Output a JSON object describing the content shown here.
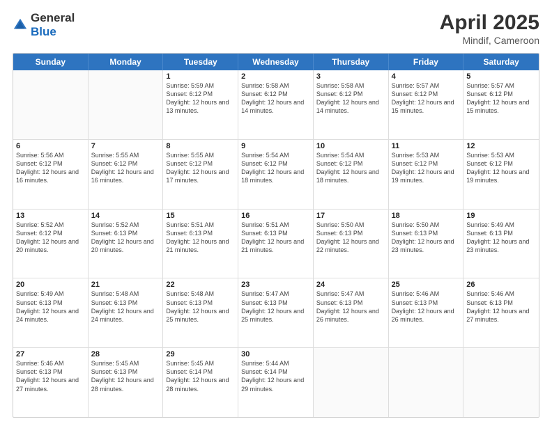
{
  "header": {
    "logo_general": "General",
    "logo_blue": "Blue",
    "title": "April 2025",
    "location": "Mindif, Cameroon"
  },
  "days_of_week": [
    "Sunday",
    "Monday",
    "Tuesday",
    "Wednesday",
    "Thursday",
    "Friday",
    "Saturday"
  ],
  "weeks": [
    [
      {
        "day": "",
        "sunrise": "",
        "sunset": "",
        "daylight": ""
      },
      {
        "day": "",
        "sunrise": "",
        "sunset": "",
        "daylight": ""
      },
      {
        "day": "1",
        "sunrise": "Sunrise: 5:59 AM",
        "sunset": "Sunset: 6:12 PM",
        "daylight": "Daylight: 12 hours and 13 minutes."
      },
      {
        "day": "2",
        "sunrise": "Sunrise: 5:58 AM",
        "sunset": "Sunset: 6:12 PM",
        "daylight": "Daylight: 12 hours and 14 minutes."
      },
      {
        "day": "3",
        "sunrise": "Sunrise: 5:58 AM",
        "sunset": "Sunset: 6:12 PM",
        "daylight": "Daylight: 12 hours and 14 minutes."
      },
      {
        "day": "4",
        "sunrise": "Sunrise: 5:57 AM",
        "sunset": "Sunset: 6:12 PM",
        "daylight": "Daylight: 12 hours and 15 minutes."
      },
      {
        "day": "5",
        "sunrise": "Sunrise: 5:57 AM",
        "sunset": "Sunset: 6:12 PM",
        "daylight": "Daylight: 12 hours and 15 minutes."
      }
    ],
    [
      {
        "day": "6",
        "sunrise": "Sunrise: 5:56 AM",
        "sunset": "Sunset: 6:12 PM",
        "daylight": "Daylight: 12 hours and 16 minutes."
      },
      {
        "day": "7",
        "sunrise": "Sunrise: 5:55 AM",
        "sunset": "Sunset: 6:12 PM",
        "daylight": "Daylight: 12 hours and 16 minutes."
      },
      {
        "day": "8",
        "sunrise": "Sunrise: 5:55 AM",
        "sunset": "Sunset: 6:12 PM",
        "daylight": "Daylight: 12 hours and 17 minutes."
      },
      {
        "day": "9",
        "sunrise": "Sunrise: 5:54 AM",
        "sunset": "Sunset: 6:12 PM",
        "daylight": "Daylight: 12 hours and 18 minutes."
      },
      {
        "day": "10",
        "sunrise": "Sunrise: 5:54 AM",
        "sunset": "Sunset: 6:12 PM",
        "daylight": "Daylight: 12 hours and 18 minutes."
      },
      {
        "day": "11",
        "sunrise": "Sunrise: 5:53 AM",
        "sunset": "Sunset: 6:12 PM",
        "daylight": "Daylight: 12 hours and 19 minutes."
      },
      {
        "day": "12",
        "sunrise": "Sunrise: 5:53 AM",
        "sunset": "Sunset: 6:12 PM",
        "daylight": "Daylight: 12 hours and 19 minutes."
      }
    ],
    [
      {
        "day": "13",
        "sunrise": "Sunrise: 5:52 AM",
        "sunset": "Sunset: 6:12 PM",
        "daylight": "Daylight: 12 hours and 20 minutes."
      },
      {
        "day": "14",
        "sunrise": "Sunrise: 5:52 AM",
        "sunset": "Sunset: 6:13 PM",
        "daylight": "Daylight: 12 hours and 20 minutes."
      },
      {
        "day": "15",
        "sunrise": "Sunrise: 5:51 AM",
        "sunset": "Sunset: 6:13 PM",
        "daylight": "Daylight: 12 hours and 21 minutes."
      },
      {
        "day": "16",
        "sunrise": "Sunrise: 5:51 AM",
        "sunset": "Sunset: 6:13 PM",
        "daylight": "Daylight: 12 hours and 21 minutes."
      },
      {
        "day": "17",
        "sunrise": "Sunrise: 5:50 AM",
        "sunset": "Sunset: 6:13 PM",
        "daylight": "Daylight: 12 hours and 22 minutes."
      },
      {
        "day": "18",
        "sunrise": "Sunrise: 5:50 AM",
        "sunset": "Sunset: 6:13 PM",
        "daylight": "Daylight: 12 hours and 23 minutes."
      },
      {
        "day": "19",
        "sunrise": "Sunrise: 5:49 AM",
        "sunset": "Sunset: 6:13 PM",
        "daylight": "Daylight: 12 hours and 23 minutes."
      }
    ],
    [
      {
        "day": "20",
        "sunrise": "Sunrise: 5:49 AM",
        "sunset": "Sunset: 6:13 PM",
        "daylight": "Daylight: 12 hours and 24 minutes."
      },
      {
        "day": "21",
        "sunrise": "Sunrise: 5:48 AM",
        "sunset": "Sunset: 6:13 PM",
        "daylight": "Daylight: 12 hours and 24 minutes."
      },
      {
        "day": "22",
        "sunrise": "Sunrise: 5:48 AM",
        "sunset": "Sunset: 6:13 PM",
        "daylight": "Daylight: 12 hours and 25 minutes."
      },
      {
        "day": "23",
        "sunrise": "Sunrise: 5:47 AM",
        "sunset": "Sunset: 6:13 PM",
        "daylight": "Daylight: 12 hours and 25 minutes."
      },
      {
        "day": "24",
        "sunrise": "Sunrise: 5:47 AM",
        "sunset": "Sunset: 6:13 PM",
        "daylight": "Daylight: 12 hours and 26 minutes."
      },
      {
        "day": "25",
        "sunrise": "Sunrise: 5:46 AM",
        "sunset": "Sunset: 6:13 PM",
        "daylight": "Daylight: 12 hours and 26 minutes."
      },
      {
        "day": "26",
        "sunrise": "Sunrise: 5:46 AM",
        "sunset": "Sunset: 6:13 PM",
        "daylight": "Daylight: 12 hours and 27 minutes."
      }
    ],
    [
      {
        "day": "27",
        "sunrise": "Sunrise: 5:46 AM",
        "sunset": "Sunset: 6:13 PM",
        "daylight": "Daylight: 12 hours and 27 minutes."
      },
      {
        "day": "28",
        "sunrise": "Sunrise: 5:45 AM",
        "sunset": "Sunset: 6:13 PM",
        "daylight": "Daylight: 12 hours and 28 minutes."
      },
      {
        "day": "29",
        "sunrise": "Sunrise: 5:45 AM",
        "sunset": "Sunset: 6:14 PM",
        "daylight": "Daylight: 12 hours and 28 minutes."
      },
      {
        "day": "30",
        "sunrise": "Sunrise: 5:44 AM",
        "sunset": "Sunset: 6:14 PM",
        "daylight": "Daylight: 12 hours and 29 minutes."
      },
      {
        "day": "",
        "sunrise": "",
        "sunset": "",
        "daylight": ""
      },
      {
        "day": "",
        "sunrise": "",
        "sunset": "",
        "daylight": ""
      },
      {
        "day": "",
        "sunrise": "",
        "sunset": "",
        "daylight": ""
      }
    ]
  ]
}
